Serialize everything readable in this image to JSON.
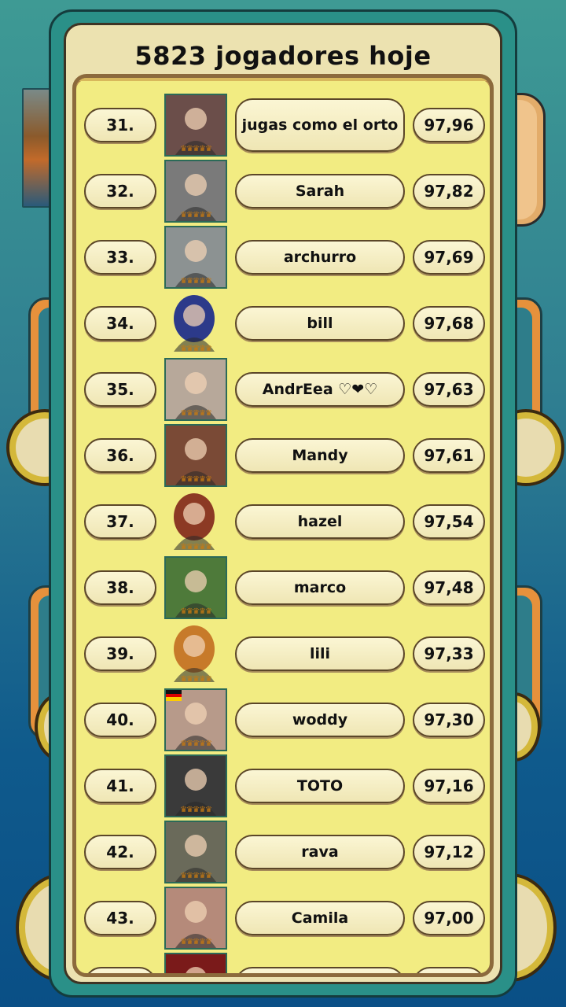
{
  "header": {
    "title": "5823 jogadores hoje"
  },
  "crown_glyphs": "♛♛♛♛♛",
  "rows": [
    {
      "rank": "31.",
      "name": "jugas como el orto",
      "score": "97,96",
      "avatar_icon": "photo-avatar-sunglasses",
      "avatar_bg": "#6b4e4a"
    },
    {
      "rank": "32.",
      "name": "Sarah",
      "score": "97,82",
      "avatar_icon": "photo-avatar-woman-bw",
      "avatar_bg": "#7a7a7a"
    },
    {
      "rank": "33.",
      "name": "archurro",
      "score": "97,69",
      "avatar_icon": "photo-avatar-sky",
      "avatar_bg": "#8c9292"
    },
    {
      "rank": "34.",
      "name": "bill",
      "score": "97,68",
      "avatar_icon": "hooded-figure-avatar",
      "avatar_bg": "#2c3a8a"
    },
    {
      "rank": "35.",
      "name": "AndrEea ♡❤♡",
      "score": "97,63",
      "avatar_icon": "photo-avatar-woman-glasses",
      "avatar_bg": "#b7a89a"
    },
    {
      "rank": "36.",
      "name": "Mandy",
      "score": "97,61",
      "avatar_icon": "photo-avatar-woman-hat",
      "avatar_bg": "#7a4a36"
    },
    {
      "rank": "37.",
      "name": "hazel",
      "score": "97,54",
      "avatar_icon": "cartoon-avatar-brown-hair",
      "avatar_bg": "#8c3a24"
    },
    {
      "rank": "38.",
      "name": "marco",
      "score": "97,48",
      "avatar_icon": "photo-avatar-stadium",
      "avatar_bg": "#4e7a3a"
    },
    {
      "rank": "39.",
      "name": "lili",
      "score": "97,33",
      "avatar_icon": "cartoon-avatar-blonde",
      "avatar_bg": "#c77a2a"
    },
    {
      "rank": "40.",
      "name": "woddy",
      "score": "97,30",
      "avatar_icon": "photo-avatar-man-with-pig",
      "avatar_bg": "#b79a8a"
    },
    {
      "rank": "41.",
      "name": "TOTO",
      "score": "97,16",
      "avatar_icon": "photo-avatar-child",
      "avatar_bg": "#3a3a3a"
    },
    {
      "rank": "42.",
      "name": "rava",
      "score": "97,12",
      "avatar_icon": "photo-avatar-man-outdoors",
      "avatar_bg": "#6a6a5a"
    },
    {
      "rank": "43.",
      "name": "Camila",
      "score": "97,00",
      "avatar_icon": "photo-avatar-woman-smile",
      "avatar_bg": "#b58a7a"
    }
  ],
  "partial_row": {
    "avatar_icon": "photo-avatar-red-flower",
    "avatar_bg": "#7a1a1a"
  },
  "colors": {
    "panel_teal": "#2a9088",
    "list_yellow": "#f2ec82",
    "pill_cream": "#f5eec4",
    "crown_gold": "#c77a12"
  }
}
